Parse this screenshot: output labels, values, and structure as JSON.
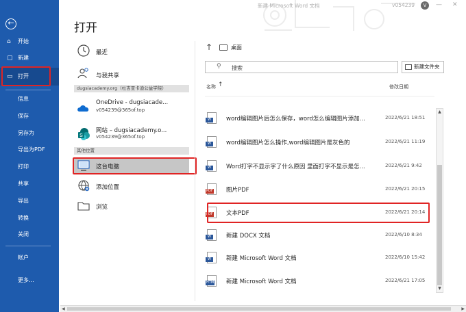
{
  "window": {
    "doc_title": "新建 Microsoft Word 文档",
    "user_id": "v054239",
    "avatar_letter": "V",
    "minimize": "—",
    "close": "✕"
  },
  "nav": {
    "back": "←",
    "items": [
      {
        "label": "开始",
        "icon": "home-icon",
        "glyph": "⌂"
      },
      {
        "label": "新建",
        "icon": "new-document-icon",
        "glyph": "▢"
      },
      {
        "label": "打开",
        "icon": "folder-open-icon",
        "glyph": "▭",
        "active": true
      },
      {
        "label": "信息"
      },
      {
        "label": "保存"
      },
      {
        "label": "另存为"
      },
      {
        "label": "导出为PDF"
      },
      {
        "label": "打印"
      },
      {
        "label": "共享"
      },
      {
        "label": "导出"
      },
      {
        "label": "转换"
      },
      {
        "label": "关闭"
      },
      {
        "label": "帐户"
      },
      {
        "label": "更多..."
      }
    ]
  },
  "page_title": "打开",
  "places": {
    "recent": "最近",
    "shared": "与我共享",
    "org_header": "dugsiacademy.org（杜吉亚卡迪公益学院）",
    "onedrive": {
      "label": "OneDrive - dugsiacade...",
      "sub": "v054239@365of.top"
    },
    "sites": {
      "label": "网站 – dugsiacademy.o...",
      "sub": "v054239@365of.top"
    },
    "other_header": "其他位置",
    "this_pc": "这台电脑",
    "add_place": "添加位置",
    "browse": "浏览"
  },
  "breadcrumb": "桌面",
  "search_placeholder": "搜索",
  "new_folder": "新建文件夹",
  "columns": {
    "name": "名称",
    "date": "修改日期"
  },
  "files": [
    {
      "name": "word编辑图片后怎么保存，word怎么编辑图片添加...",
      "date": "2022/6/21 18:51",
      "type": "W",
      "color": "#2b579a"
    },
    {
      "name": "word编辑图片怎么操作,word编辑图片是灰色的",
      "date": "2022/6/21 11:19",
      "type": "W",
      "color": "#2b579a"
    },
    {
      "name": "Word打字不显示字了什么原因 里面打字不显示是怎...",
      "date": "2022/6/21 9:42",
      "type": "W",
      "color": "#2b579a"
    },
    {
      "name": "图片PDF",
      "date": "2022/6/21 20:15",
      "type": "PDF",
      "color": "#c0392b"
    },
    {
      "name": "文本PDF",
      "date": "2022/6/21 20:14",
      "type": "PDF",
      "color": "#c0392b"
    },
    {
      "name": "新建 DOCX 文档",
      "date": "2022/6/10 8:34",
      "type": "W",
      "color": "#2b579a"
    },
    {
      "name": "新建 Microsoft Word 文档",
      "date": "2022/6/10 15:42",
      "type": "W",
      "color": "#2b579a"
    },
    {
      "name": "新建 Microsoft Word 文档",
      "date": "2022/6/21 17:05",
      "type": "HTM",
      "color": "#2b579a"
    }
  ],
  "colors": {
    "nav_bg": "#1e5bad",
    "highlight": "#e02424"
  }
}
